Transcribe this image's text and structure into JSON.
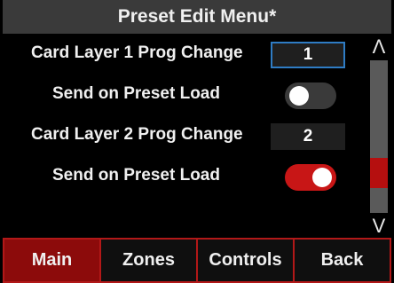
{
  "header": {
    "title": "Preset Edit Menu*"
  },
  "rows": [
    {
      "label": "Card Layer 1 Prog Change",
      "type": "value",
      "value": "1",
      "selected": true
    },
    {
      "label": "Send on Preset Load",
      "type": "toggle",
      "state": "off"
    },
    {
      "label": "Card Layer 2 Prog Change",
      "type": "value",
      "value": "2",
      "selected": false
    },
    {
      "label": "Send on Preset Load",
      "type": "toggle",
      "state": "on"
    }
  ],
  "scrollbar": {
    "up_icon": "chevron-up-icon",
    "up_glyph": "Λ",
    "down_icon": "chevron-down-icon",
    "down_glyph": "V",
    "position_fraction": 0.8,
    "visible_fraction": 0.2
  },
  "tabs": [
    {
      "label": "Main",
      "active": true
    },
    {
      "label": "Zones",
      "active": false
    },
    {
      "label": "Controls",
      "active": false
    },
    {
      "label": "Back",
      "active": false
    }
  ],
  "colors": {
    "accent_red": "#c81616",
    "tab_active": "#8c0b0b",
    "tab_border": "#b21818",
    "selection_blue": "#2f7cc4",
    "title_bar": "#3a3a3a",
    "toggle_off": "#3a3a3a",
    "scroll_track": "#5a5a5a"
  }
}
